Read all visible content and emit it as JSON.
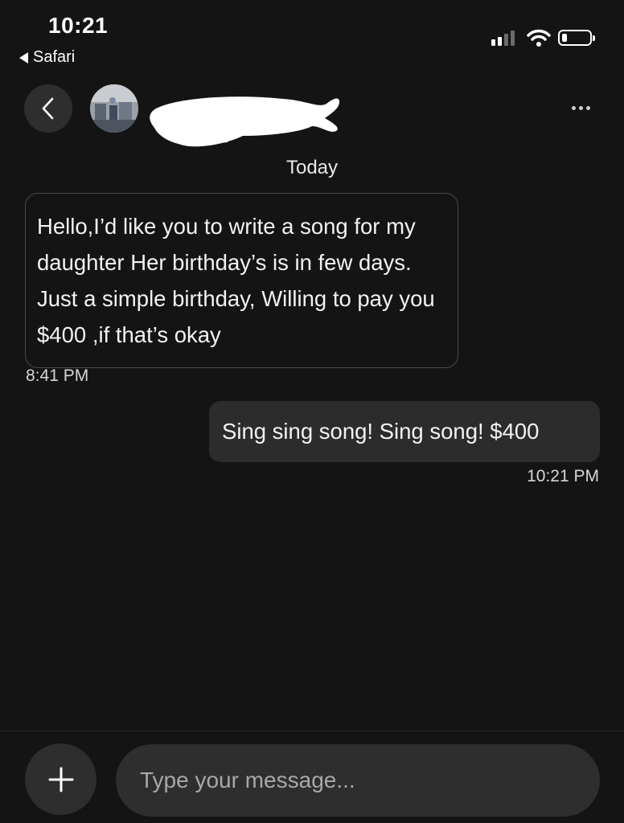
{
  "status_bar": {
    "time": "10:21",
    "back_app_label": "Safari",
    "signal_icon": "cellular-signal-icon",
    "wifi_icon": "wifi-icon",
    "battery_icon": "battery-icon",
    "battery_level": 0.2
  },
  "header": {
    "back_icon": "chevron-left-icon",
    "avatar": "contact-avatar",
    "contact_name": "",
    "more_icon": "more-dots-icon"
  },
  "conversation": {
    "date_separator": "Today",
    "messages": [
      {
        "direction": "incoming",
        "text": "Hello,I’d like you to write a song for my daughter Her birthday’s is in few days. Just a simple birthday, Willing to pay you $400 ,if that’s okay",
        "time": "8:41 PM"
      },
      {
        "direction": "outgoing",
        "text": "Sing sing song! Sing song! $400",
        "time": "10:21 PM"
      }
    ]
  },
  "composer": {
    "add_icon": "plus-icon",
    "placeholder": "Type your message...",
    "value": ""
  },
  "colors": {
    "background": "#141414",
    "bubble_outgoing": "#2c2c2c",
    "bubble_incoming_border": "#4a4a4a",
    "control_fill": "#2e2e2e"
  }
}
